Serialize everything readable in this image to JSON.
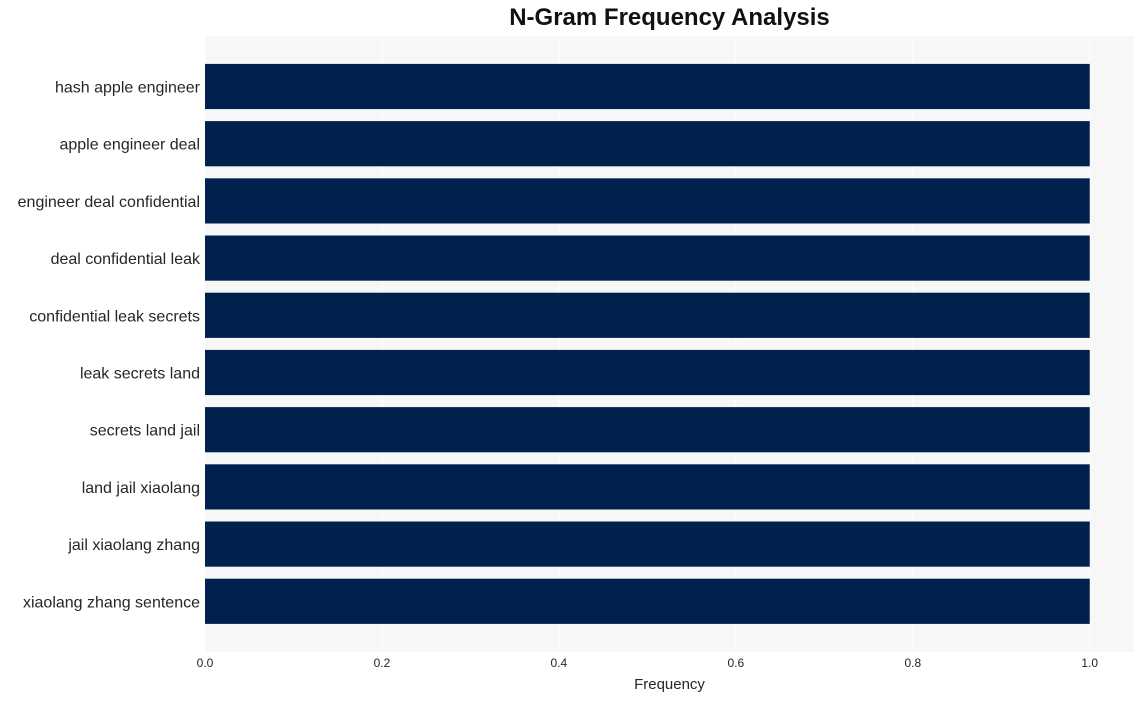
{
  "chart_data": {
    "type": "bar",
    "orientation": "horizontal",
    "title": "N-Gram Frequency Analysis",
    "xlabel": "Frequency",
    "ylabel": "",
    "categories": [
      "hash apple engineer",
      "apple engineer deal",
      "engineer deal confidential",
      "deal confidential leak",
      "confidential leak secrets",
      "leak secrets land",
      "secrets land jail",
      "land jail xiaolang",
      "jail xiaolang zhang",
      "xiaolang zhang sentence"
    ],
    "values": [
      1,
      1,
      1,
      1,
      1,
      1,
      1,
      1,
      1,
      1
    ],
    "xlim": [
      0,
      1.05
    ],
    "xticks": [
      0.0,
      0.2,
      0.4,
      0.6,
      0.8,
      1.0
    ],
    "xtick_labels": [
      "0.0",
      "0.2",
      "0.4",
      "0.6",
      "0.8",
      "1.0"
    ],
    "grid": true,
    "legend": "none",
    "colors": {
      "bar": "#00214d",
      "plot_background": "#f7f7f7",
      "grid": "#ffffff"
    }
  }
}
